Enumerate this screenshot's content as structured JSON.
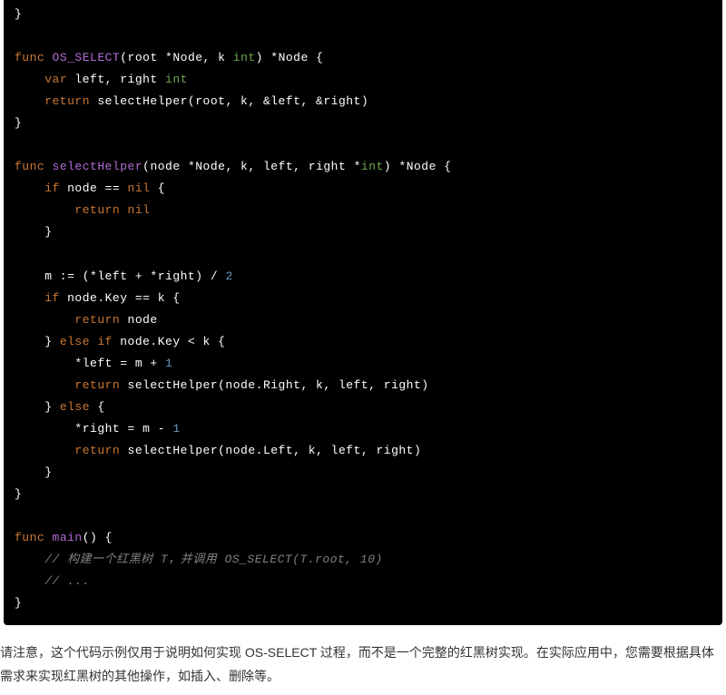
{
  "code": {
    "l01": "}",
    "l02": "",
    "l03a": "func",
    "l03b": " OS_SELECT",
    "l03c": "(root *Node, k ",
    "l03d": "int",
    "l03e": ") *Node {",
    "l04a": "    var",
    "l04b": " left, right ",
    "l04c": "int",
    "l05a": "    return",
    "l05b": " selectHelper(root, k, &left, &right)",
    "l06": "}",
    "l07": "",
    "l08a": "func",
    "l08b": " selectHelper",
    "l08c": "(node *Node, k, left, right *",
    "l08d": "int",
    "l08e": ") *Node {",
    "l09a": "    if",
    "l09b": " node == ",
    "l09c": "nil",
    "l09d": " {",
    "l10a": "        return ",
    "l10b": "nil",
    "l11": "    }",
    "l12": "",
    "l13a": "    m := (*left + *right) / ",
    "l13b": "2",
    "l14a": "    if",
    "l14b": " node.Key == k {",
    "l15a": "        return",
    "l15b": " node",
    "l16a": "    } ",
    "l16b": "else if",
    "l16c": " node.Key < k {",
    "l17a": "        *left = m + ",
    "l17b": "1",
    "l18a": "        return",
    "l18b": " selectHelper(node.Right, k, left, right)",
    "l19a": "    } ",
    "l19b": "else",
    "l19c": " {",
    "l20a": "        *right = m - ",
    "l20b": "1",
    "l21a": "        return",
    "l21b": " selectHelper(node.Left, k, left, right)",
    "l22": "    }",
    "l23": "}",
    "l24": "",
    "l25a": "func",
    "l25b": " main",
    "l25c": "() {",
    "l26": "    // 构建一个红黑树 T，并调用 OS_SELECT(T.root, 10)",
    "l27": "    // ...",
    "l28": "}"
  },
  "note": "请注意，这个代码示例仅用于说明如何实现 OS-SELECT 过程，而不是一个完整的红黑树实现。在实际应用中，您需要根据具体需求来实现红黑树的其他操作，如插入、删除等。"
}
